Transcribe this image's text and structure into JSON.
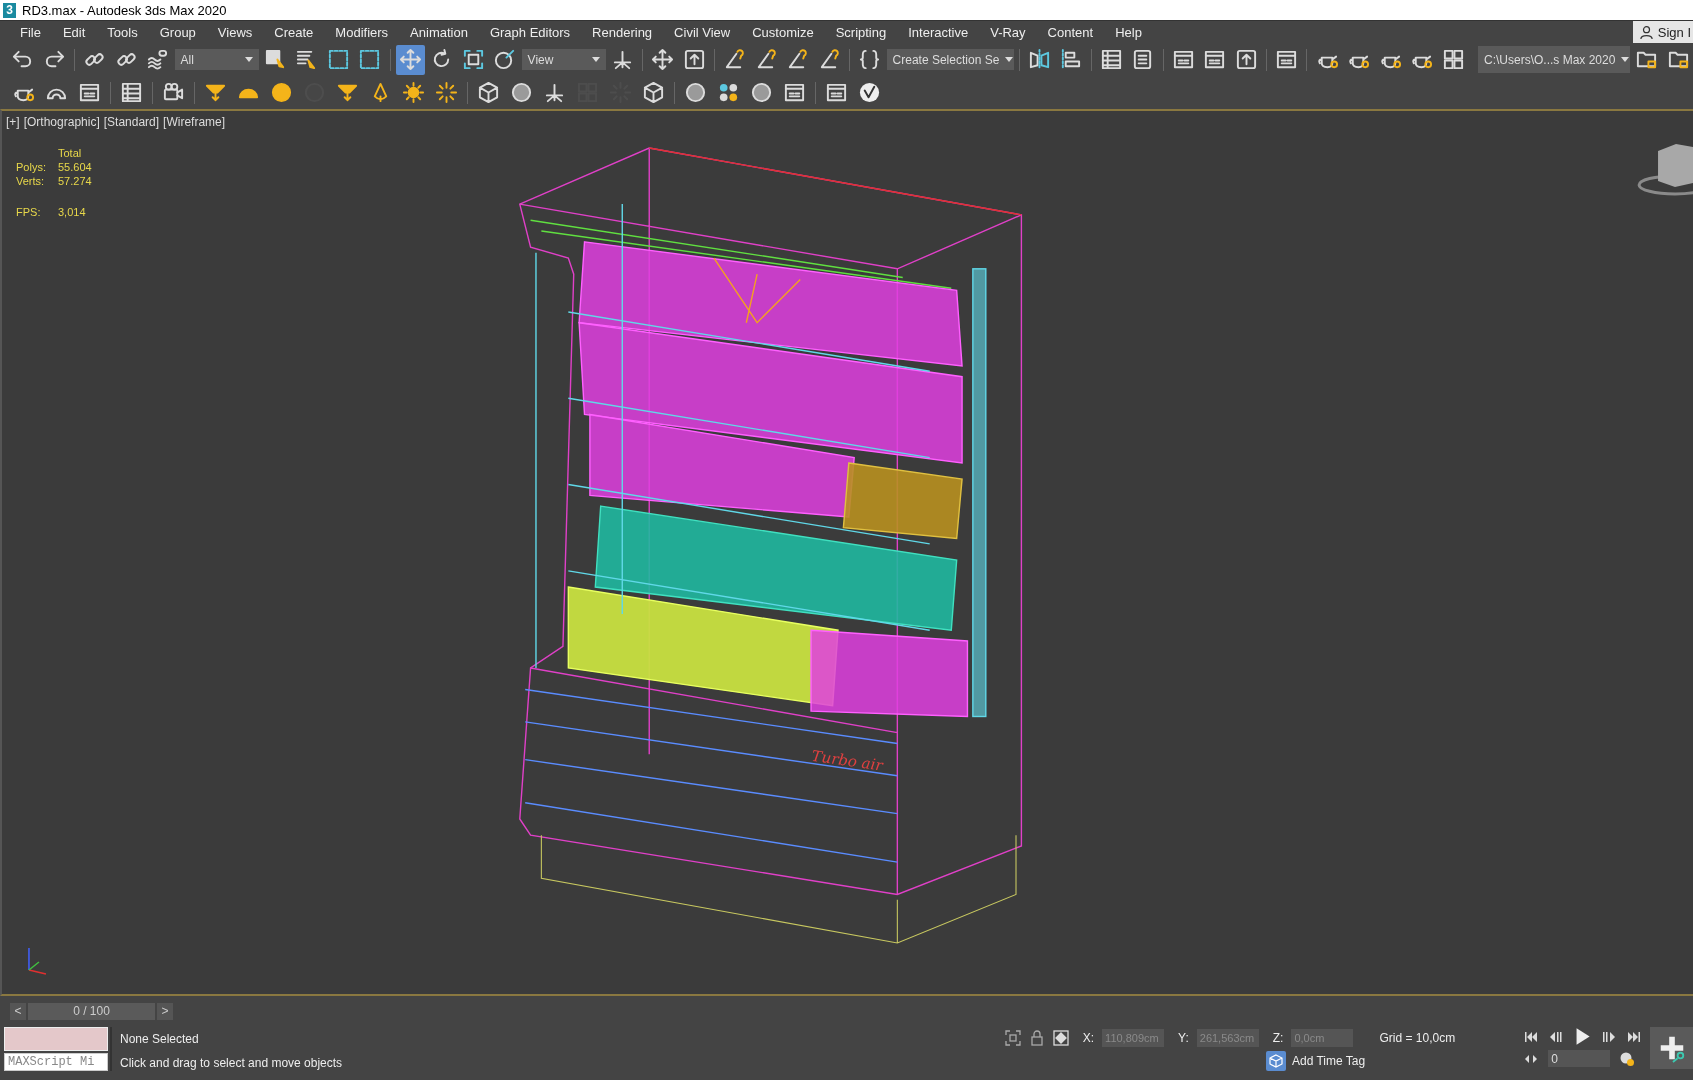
{
  "window": {
    "title": "RD3.max - Autodesk 3ds Max 2020",
    "icon_text": "3"
  },
  "menu_bar": [
    {
      "label": "File"
    },
    {
      "label": "Edit"
    },
    {
      "label": "Tools"
    },
    {
      "label": "Group"
    },
    {
      "label": "Views"
    },
    {
      "label": "Create"
    },
    {
      "label": "Modifiers"
    },
    {
      "label": "Animation"
    },
    {
      "label": "Graph Editors"
    },
    {
      "label": "Rendering"
    },
    {
      "label": "Civil View"
    },
    {
      "label": "Customize"
    },
    {
      "label": "Scripting"
    },
    {
      "label": "Interactive"
    },
    {
      "label": "V-Ray"
    },
    {
      "label": "Content"
    },
    {
      "label": "Help"
    }
  ],
  "sign_in": "Sign I",
  "toolbar_1": [
    {
      "kind": "undo",
      "selected": false
    },
    {
      "kind": "redo",
      "selected": false
    },
    {
      "kind": "separator"
    },
    {
      "kind": "link",
      "selected": false
    },
    {
      "kind": "link",
      "selected": false
    },
    {
      "kind": "bind",
      "selected": false
    },
    {
      "kind": "dropdown",
      "value": "All"
    },
    {
      "kind": "select",
      "selected": false
    },
    {
      "kind": "select-list",
      "selected": false
    },
    {
      "kind": "region",
      "selected": false
    },
    {
      "kind": "region",
      "selected": false
    },
    {
      "kind": "separator"
    },
    {
      "kind": "move",
      "selected": true
    },
    {
      "kind": "rotate",
      "selected": false
    },
    {
      "kind": "scale",
      "selected": false
    },
    {
      "kind": "pivot",
      "selected": false
    },
    {
      "kind": "dropdown",
      "value": "View"
    },
    {
      "kind": "axis",
      "selected": false
    },
    {
      "kind": "separator"
    },
    {
      "kind": "move",
      "selected": false
    },
    {
      "kind": "upload",
      "selected": false
    },
    {
      "kind": "separator"
    },
    {
      "kind": "snap",
      "selected": false
    },
    {
      "kind": "snap",
      "selected": false
    },
    {
      "kind": "snap",
      "selected": false
    },
    {
      "kind": "snap",
      "selected": false
    },
    {
      "kind": "separator"
    },
    {
      "kind": "script",
      "selected": false
    },
    {
      "kind": "dropdown",
      "value": "Create Selection Se"
    },
    {
      "kind": "separator"
    },
    {
      "kind": "mirror",
      "selected": false
    },
    {
      "kind": "align",
      "selected": false
    },
    {
      "kind": "separator"
    },
    {
      "kind": "table",
      "selected": false
    },
    {
      "kind": "layers",
      "selected": false
    },
    {
      "kind": "separator"
    },
    {
      "kind": "window",
      "selected": false
    },
    {
      "kind": "window",
      "selected": false
    },
    {
      "kind": "upload",
      "selected": false
    },
    {
      "kind": "separator"
    },
    {
      "kind": "window",
      "selected": false
    },
    {
      "kind": "separator"
    },
    {
      "kind": "teapot",
      "selected": false
    },
    {
      "kind": "teapot",
      "selected": false
    },
    {
      "kind": "teapot",
      "selected": false
    },
    {
      "kind": "teapot",
      "selected": false
    },
    {
      "kind": "grid",
      "selected": false
    },
    {
      "kind": "path",
      "value": "C:\\Users\\O...s Max 2020"
    },
    {
      "kind": "folder",
      "selected": false
    },
    {
      "kind": "folder",
      "selected": false
    }
  ],
  "toolbar_2": [
    {
      "kind": "teapot",
      "disabled": false
    },
    {
      "kind": "dome",
      "disabled": false
    },
    {
      "kind": "window",
      "disabled": false
    },
    {
      "kind": "separator"
    },
    {
      "kind": "table",
      "disabled": false
    },
    {
      "kind": "separator"
    },
    {
      "kind": "camera",
      "disabled": false
    },
    {
      "kind": "separator"
    },
    {
      "kind": "light-spot",
      "disabled": false
    },
    {
      "kind": "light-dome",
      "disabled": false
    },
    {
      "kind": "light-sphere",
      "disabled": false
    },
    {
      "kind": "sphere",
      "disabled": true
    },
    {
      "kind": "light-spot",
      "disabled": false
    },
    {
      "kind": "light-bulb",
      "disabled": false
    },
    {
      "kind": "sun",
      "disabled": false
    },
    {
      "kind": "burst",
      "disabled": false
    },
    {
      "kind": "separator"
    },
    {
      "kind": "cube",
      "disabled": false
    },
    {
      "kind": "sphere",
      "disabled": false
    },
    {
      "kind": "axis",
      "disabled": false
    },
    {
      "kind": "grid",
      "disabled": true
    },
    {
      "kind": "burst",
      "disabled": true
    },
    {
      "kind": "cube",
      "disabled": false
    },
    {
      "kind": "separator"
    },
    {
      "kind": "sphere",
      "disabled": false
    },
    {
      "kind": "dots",
      "disabled": false
    },
    {
      "kind": "sphere",
      "disabled": false
    },
    {
      "kind": "window",
      "disabled": false
    },
    {
      "kind": "separator"
    },
    {
      "kind": "window",
      "disabled": false
    },
    {
      "kind": "vlogo",
      "disabled": false
    }
  ],
  "viewport": {
    "labels": [
      "[+]",
      "[Orthographic]",
      "[Standard]",
      "[Wireframe]"
    ],
    "stats": {
      "header": "Total",
      "rows": [
        {
          "label": "Polys:",
          "value": "55.604"
        },
        {
          "label": "Verts:",
          "value": "57.274"
        }
      ],
      "fps_label": "FPS:",
      "fps_value": "3,014"
    },
    "model_logo": "Turbo air"
  },
  "time_slider": {
    "prev": "<",
    "frame": "0 / 100",
    "next": ">"
  },
  "status": {
    "maxscript_placeholder": "MAXScript Mi",
    "selection": "None Selected",
    "prompt": "Click and drag to select and move objects",
    "coords": [
      {
        "label": "X:",
        "value": "110,809cm",
        "disabled": true
      },
      {
        "label": "Y:",
        "value": "261,563cm",
        "disabled": true
      },
      {
        "label": "Z:",
        "value": "0,0cm",
        "disabled": true
      }
    ],
    "grid": "Grid = 10,0cm",
    "add_time_tag": "Add Time Tag",
    "frame_field": "0"
  }
}
